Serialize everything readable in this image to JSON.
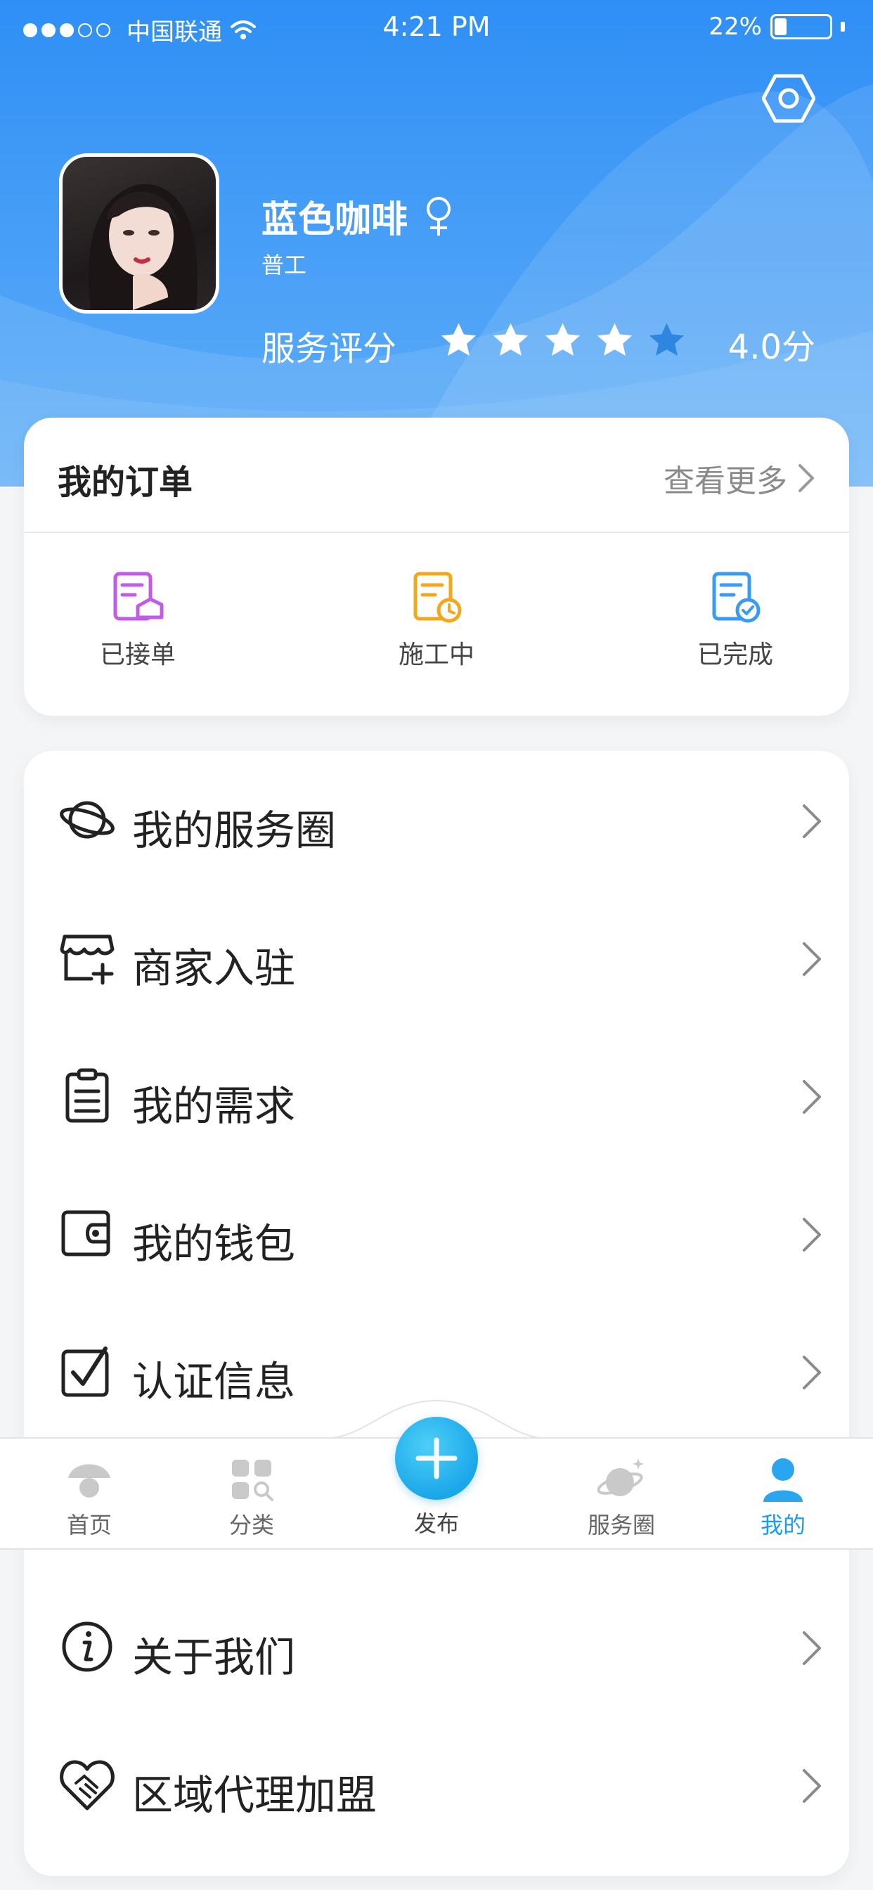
{
  "status_bar": {
    "carrier": "中国联通",
    "time": "4:21 PM",
    "battery": "22%",
    "battery_level": 0.22
  },
  "profile": {
    "name": "蓝色咖啡",
    "gender_icon": "female-icon",
    "role": "普工",
    "rating_label": "服务评分",
    "rating_stars": 4,
    "rating_max": 5,
    "rating_value": "4.0分"
  },
  "orders": {
    "title": "我的订单",
    "more": "查看更多",
    "items": [
      {
        "label": "已接单",
        "icon": "order-accepted-icon",
        "color": "#c15be8"
      },
      {
        "label": "施工中",
        "icon": "order-in-progress-icon",
        "color": "#f2a71c"
      },
      {
        "label": "已完成",
        "icon": "order-completed-icon",
        "color": "#3a9bf2"
      }
    ]
  },
  "menu": {
    "items": [
      {
        "label": "我的服务圈",
        "icon": "planet-icon"
      },
      {
        "label": "商家入驻",
        "icon": "store-add-icon"
      },
      {
        "label": "我的需求",
        "icon": "clipboard-icon"
      },
      {
        "label": "我的钱包",
        "icon": "wallet-icon"
      },
      {
        "label": "认证信息",
        "icon": "checkbox-icon"
      },
      {
        "label": "关于我们",
        "icon": "info-icon"
      },
      {
        "label": "区域代理加盟",
        "icon": "handshake-heart-icon"
      }
    ]
  },
  "tabbar": {
    "items": [
      {
        "label": "首页",
        "icon": "home-icon"
      },
      {
        "label": "分类",
        "icon": "category-icon"
      },
      {
        "label": "发布",
        "icon": "plus-icon"
      },
      {
        "label": "服务圈",
        "icon": "planet-icon"
      },
      {
        "label": "我的",
        "icon": "user-icon"
      }
    ],
    "active": "我的"
  },
  "colors": {
    "header_blue": "#2f8ff5",
    "accent": "#1e9bf0",
    "star_filled": "#ffffff",
    "star_empty": "#2f86e0"
  }
}
